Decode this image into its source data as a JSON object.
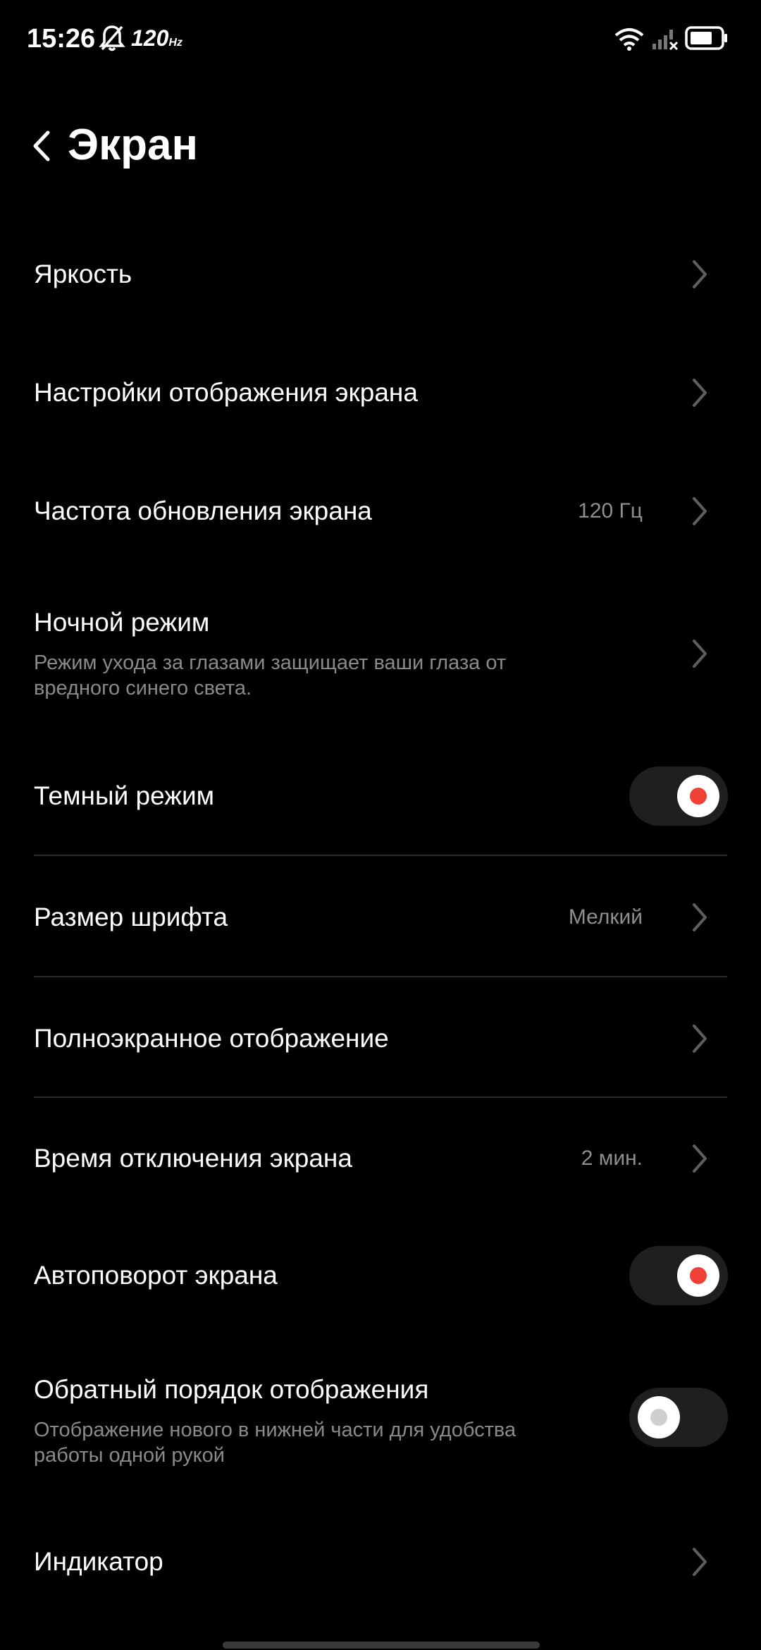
{
  "status_bar": {
    "time": "15:26",
    "refresh_badge": "120",
    "refresh_unit": "Hz"
  },
  "header": {
    "title": "Экран"
  },
  "colors": {
    "accent": "#ef4136",
    "background": "#000000",
    "secondary_text": "#8a8a8a"
  },
  "settings": {
    "brightness": {
      "label": "Яркость"
    },
    "display_settings": {
      "label": "Настройки отображения экрана"
    },
    "refresh_rate": {
      "label": "Частота обновления экрана",
      "value": "120 Гц"
    },
    "night_mode": {
      "label": "Ночной режим",
      "description": "Режим ухода за глазами защищает ваши глаза от вредного синего света."
    },
    "dark_mode": {
      "label": "Темный режим",
      "enabled": true
    },
    "font_size": {
      "label": "Размер шрифта",
      "value": "Мелкий"
    },
    "full_screen": {
      "label": "Полноэкранное отображение"
    },
    "screen_timeout": {
      "label": "Время отключения экрана",
      "value": "2 мин."
    },
    "auto_rotate": {
      "label": "Автоповорот экрана",
      "enabled": true
    },
    "reverse_order": {
      "label": "Обратный порядок отображения",
      "description": "Отображение нового в нижней части для удобства работы одной рукой",
      "enabled": false
    },
    "indicator": {
      "label": "Индикатор"
    }
  }
}
